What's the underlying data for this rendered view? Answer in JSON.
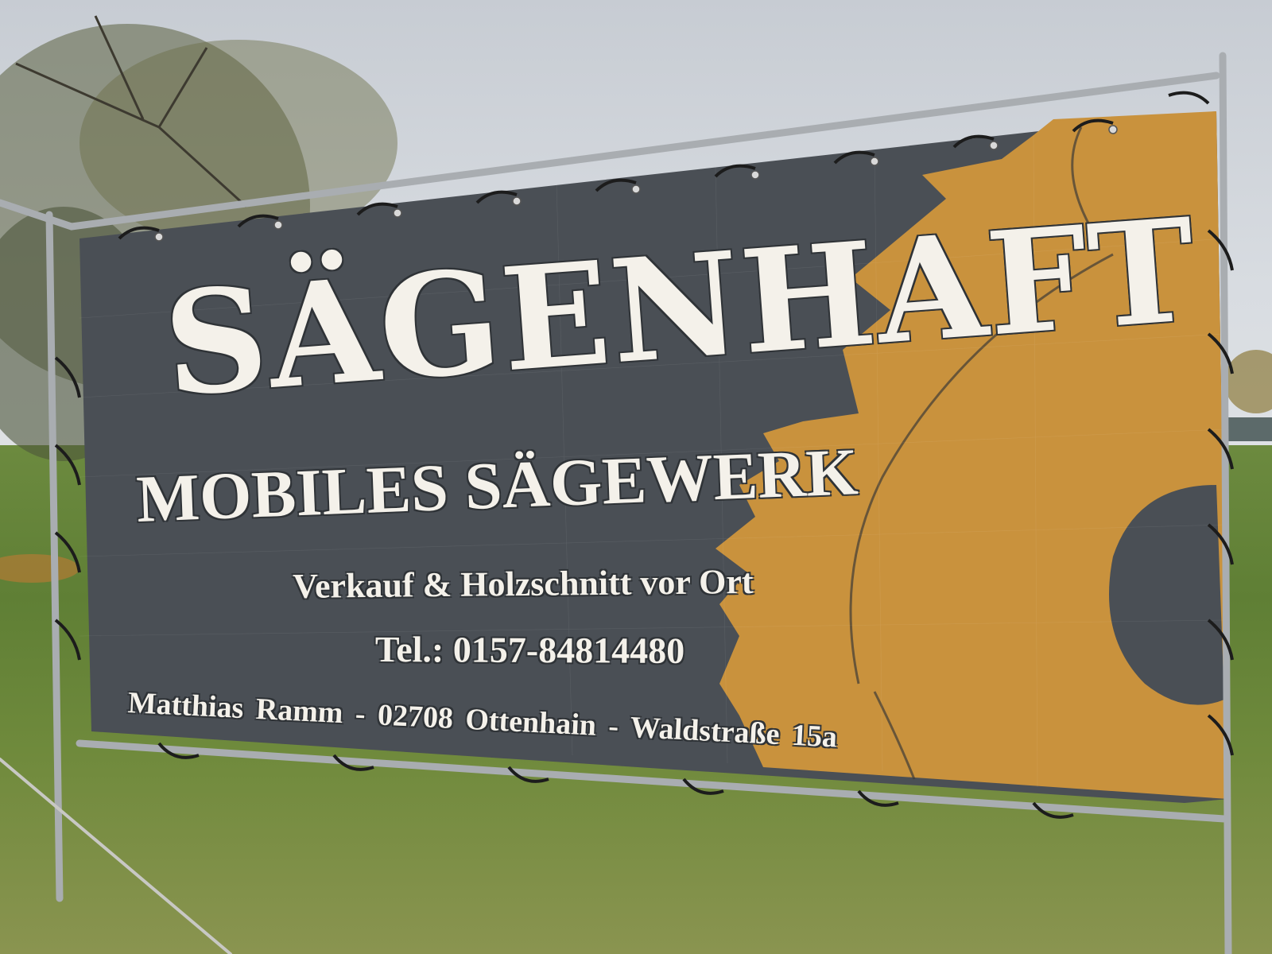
{
  "sign": {
    "title": "SÄGENHAFT",
    "subtitle": "MOBILES SÄGEWERK",
    "service_line": "Verkauf  & Holzschnitt vor Ort",
    "phone_line": "Tel.: 0157-84814480",
    "address_line": "Matthias Ramm  -  02708 Ottenhain  -  Waldstraße 15a"
  },
  "colors": {
    "banner_gray": "#4a4f55",
    "banner_ochre": "#c9923d",
    "text_cream": "#f4f1ea",
    "outline_dark": "#2f3337",
    "frame_metal": "#a9adb1",
    "grass": "#6c8a3f",
    "sky": "#d2d6db"
  }
}
